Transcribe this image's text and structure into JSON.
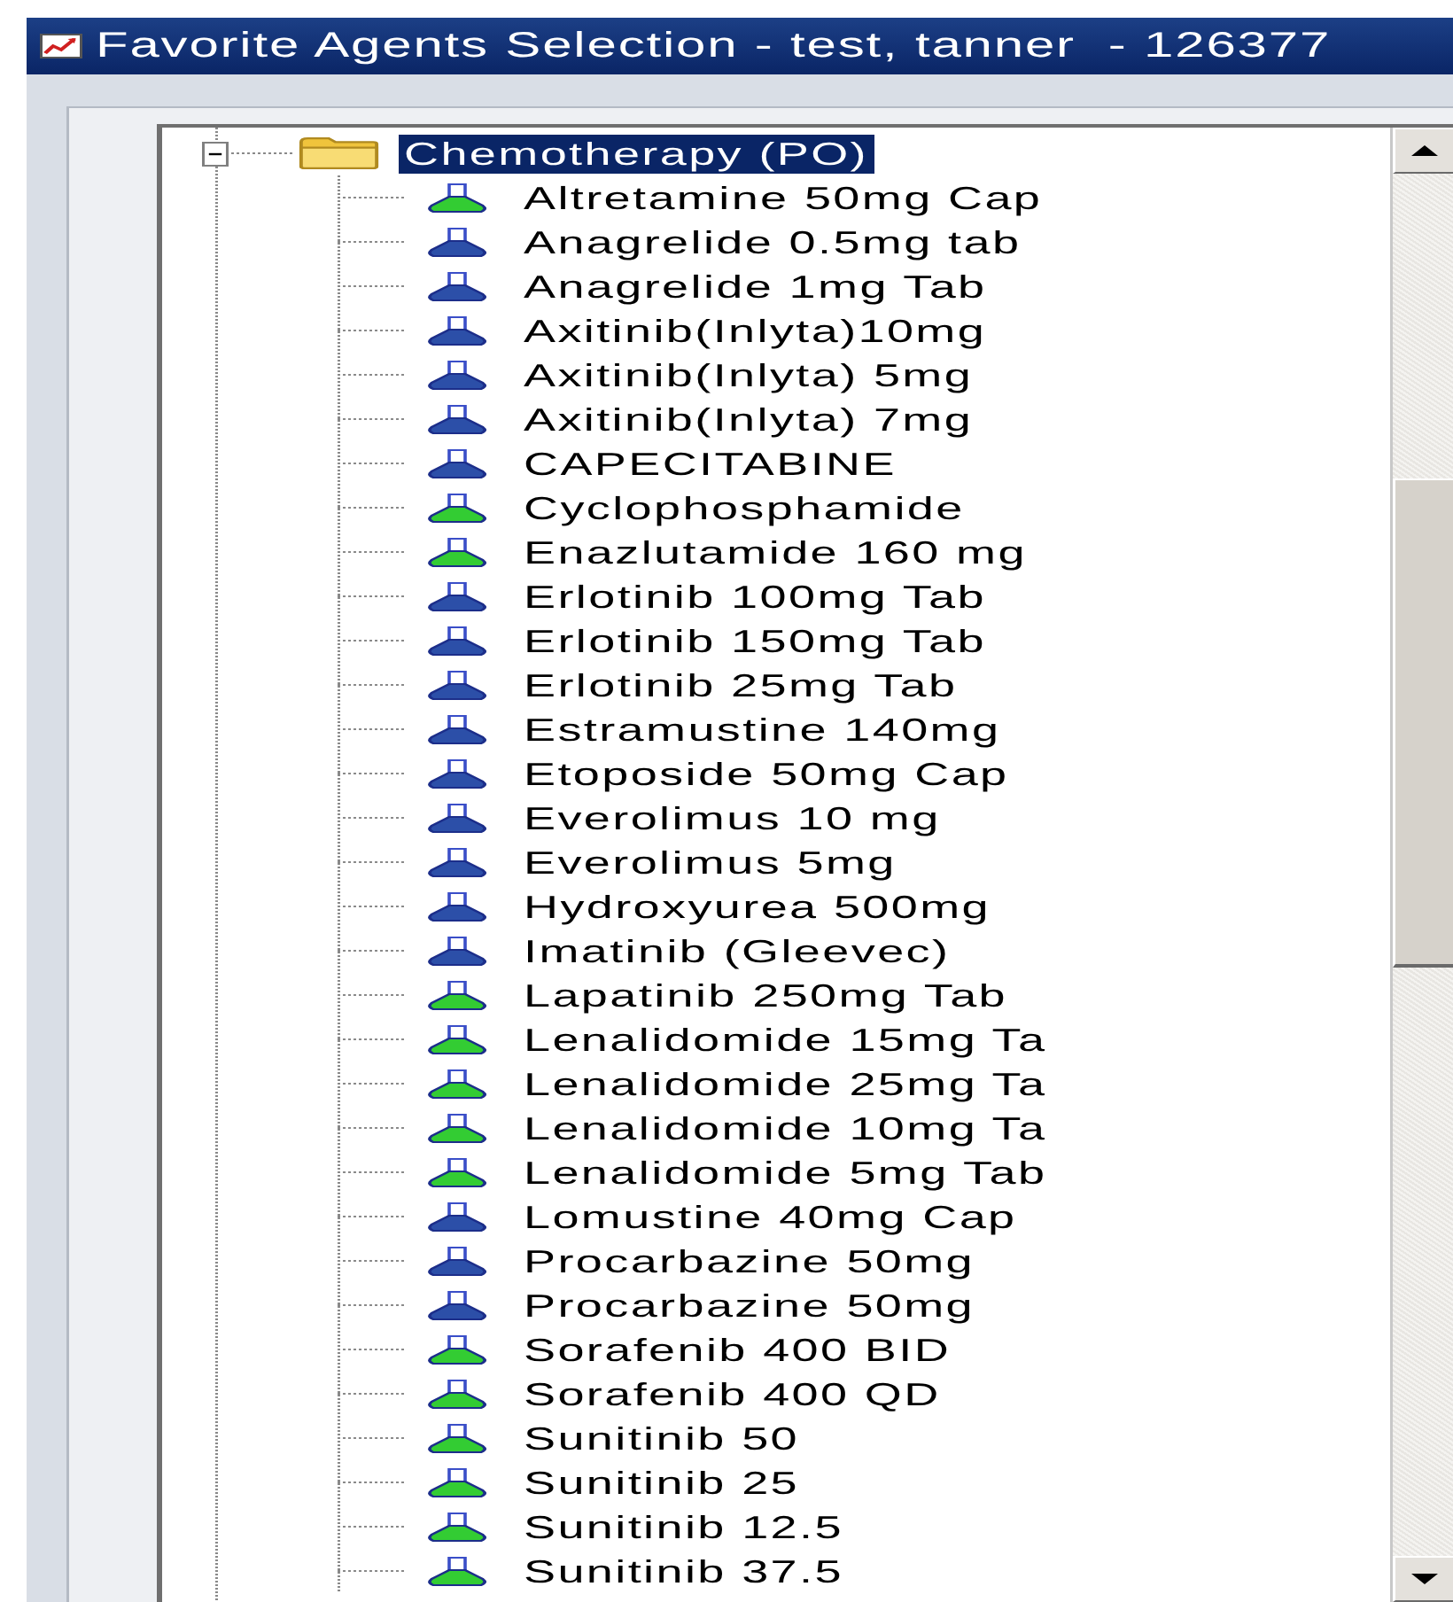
{
  "window": {
    "title": "Favorite Agents Selection - test, tanner  - 126377"
  },
  "tree": {
    "items": [
      {
        "label": "Chemotherapy (PO)",
        "expanded": true,
        "selected": true,
        "children": [
          {
            "label": "Altretamine 50mg Cap",
            "color": "#33cc33",
            "selected": false
          },
          {
            "label": "Anagrelide 0.5mg tab",
            "color": "#2c4fa8",
            "selected": false
          },
          {
            "label": "Anagrelide 1mg Tab",
            "color": "#2c4fa8",
            "selected": false
          },
          {
            "label": "Axitinib(Inlyta)10mg",
            "color": "#2c4fa8",
            "selected": false
          },
          {
            "label": "Axitinib(Inlyta) 5mg",
            "color": "#2c4fa8",
            "selected": false
          },
          {
            "label": "Axitinib(Inlyta) 7mg",
            "color": "#2c4fa8",
            "selected": false
          },
          {
            "label": "CAPECITABINE",
            "color": "#2c4fa8",
            "selected": false
          },
          {
            "label": "Cyclophosphamide",
            "color": "#33cc33",
            "selected": false
          },
          {
            "label": "Enazlutamide 160 mg",
            "color": "#33cc33",
            "selected": false
          },
          {
            "label": "Erlotinib 100mg Tab",
            "color": "#2c4fa8",
            "selected": false
          },
          {
            "label": "Erlotinib 150mg Tab",
            "color": "#2c4fa8",
            "selected": false
          },
          {
            "label": "Erlotinib 25mg Tab",
            "color": "#2c4fa8",
            "selected": false
          },
          {
            "label": "Estramustine 140mg",
            "color": "#2c4fa8",
            "selected": false
          },
          {
            "label": "Etoposide 50mg Cap",
            "color": "#2c4fa8",
            "selected": false
          },
          {
            "label": "Everolimus 10 mg",
            "color": "#2c4fa8",
            "selected": false
          },
          {
            "label": "Everolimus 5mg",
            "color": "#2c4fa8",
            "selected": false
          },
          {
            "label": "Hydroxyurea 500mg",
            "color": "#2c4fa8",
            "selected": false
          },
          {
            "label": "Imatinib (Gleevec)",
            "color": "#2c4fa8",
            "selected": false
          },
          {
            "label": "Lapatinib 250mg Tab",
            "color": "#33cc33",
            "selected": false
          },
          {
            "label": "Lenalidomide 15mg Ta",
            "color": "#33cc33",
            "selected": false
          },
          {
            "label": "Lenalidomide 25mg Ta",
            "color": "#33cc33",
            "selected": false
          },
          {
            "label": "Lenalidomide 10mg Ta",
            "color": "#33cc33",
            "selected": false
          },
          {
            "label": "Lenalidomide 5mg Tab",
            "color": "#33cc33",
            "selected": false
          },
          {
            "label": "Lomustine 40mg Cap",
            "color": "#2c4fa8",
            "selected": false
          },
          {
            "label": "Procarbazine 50mg",
            "color": "#2c4fa8",
            "selected": false
          },
          {
            "label": "Procarbazine 50mg",
            "color": "#2c4fa8",
            "selected": false
          },
          {
            "label": "Sorafenib 400 BID",
            "color": "#33cc33",
            "selected": false
          },
          {
            "label": "Sorafenib 400 QD",
            "color": "#33cc33",
            "selected": false
          },
          {
            "label": "Sunitinib 50",
            "color": "#33cc33",
            "selected": false
          },
          {
            "label": "Sunitinib 25",
            "color": "#33cc33",
            "selected": false
          },
          {
            "label": "Sunitinib 12.5",
            "color": "#33cc33",
            "selected": false
          },
          {
            "label": "Sunitinib 37.5",
            "color": "#33cc33",
            "selected": false
          }
        ]
      }
    ]
  }
}
